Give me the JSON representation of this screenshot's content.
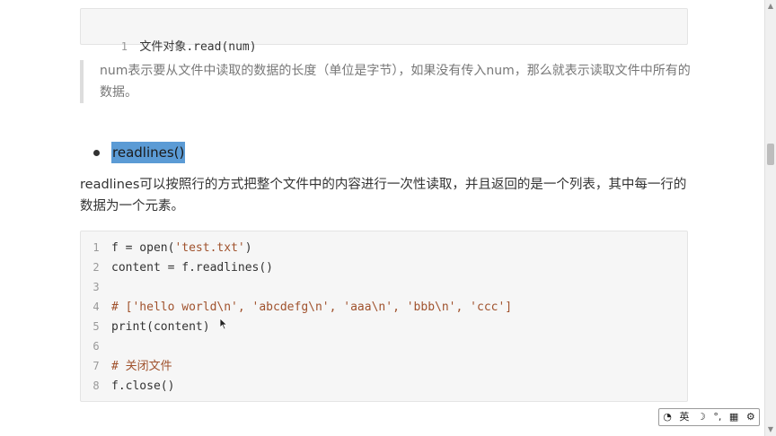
{
  "top_code": {
    "lines": [
      {
        "n": "1",
        "text": "文件对象.read(num)"
      }
    ]
  },
  "note": {
    "text": "num表示要从文件中读取的数据的长度（单位是字节），如果没有传入num，那么就表示读取文件中所有的数据。"
  },
  "bullet": {
    "label": "readlines()"
  },
  "paragraph": {
    "text": "readlines可以按照行的方式把整个文件中的内容进行一次性读取，并且返回的是一个列表，其中每一行的数据为一个元素。"
  },
  "code": {
    "lines": [
      {
        "n": "1",
        "parts": [
          {
            "t": "f = open(",
            "c": "src"
          },
          {
            "t": "'test.txt'",
            "c": "str"
          },
          {
            "t": ")",
            "c": "src"
          }
        ]
      },
      {
        "n": "2",
        "parts": [
          {
            "t": "content = f.readlines()",
            "c": "src"
          }
        ]
      },
      {
        "n": "3",
        "parts": [
          {
            "t": "",
            "c": "src"
          }
        ]
      },
      {
        "n": "4",
        "parts": [
          {
            "t": "# ['hello world\\n', 'abcdefg\\n', 'aaa\\n', 'bbb\\n', 'ccc']",
            "c": "cmt"
          }
        ]
      },
      {
        "n": "5",
        "parts": [
          {
            "t": "print(content)",
            "c": "src"
          }
        ]
      },
      {
        "n": "6",
        "parts": [
          {
            "t": "",
            "c": "src"
          }
        ]
      },
      {
        "n": "7",
        "parts": [
          {
            "t": "# 关闭文件",
            "c": "cmt"
          }
        ]
      },
      {
        "n": "8",
        "parts": [
          {
            "t": "f.close()",
            "c": "src"
          }
        ]
      }
    ]
  },
  "ime_bar": {
    "items": [
      "◔",
      "英",
      "☽",
      "°,",
      "▦",
      "⚙"
    ]
  },
  "colors": {
    "highlight": "#5b9bd5",
    "comment": "#a0522d",
    "code_bg": "#f6f6f6"
  }
}
